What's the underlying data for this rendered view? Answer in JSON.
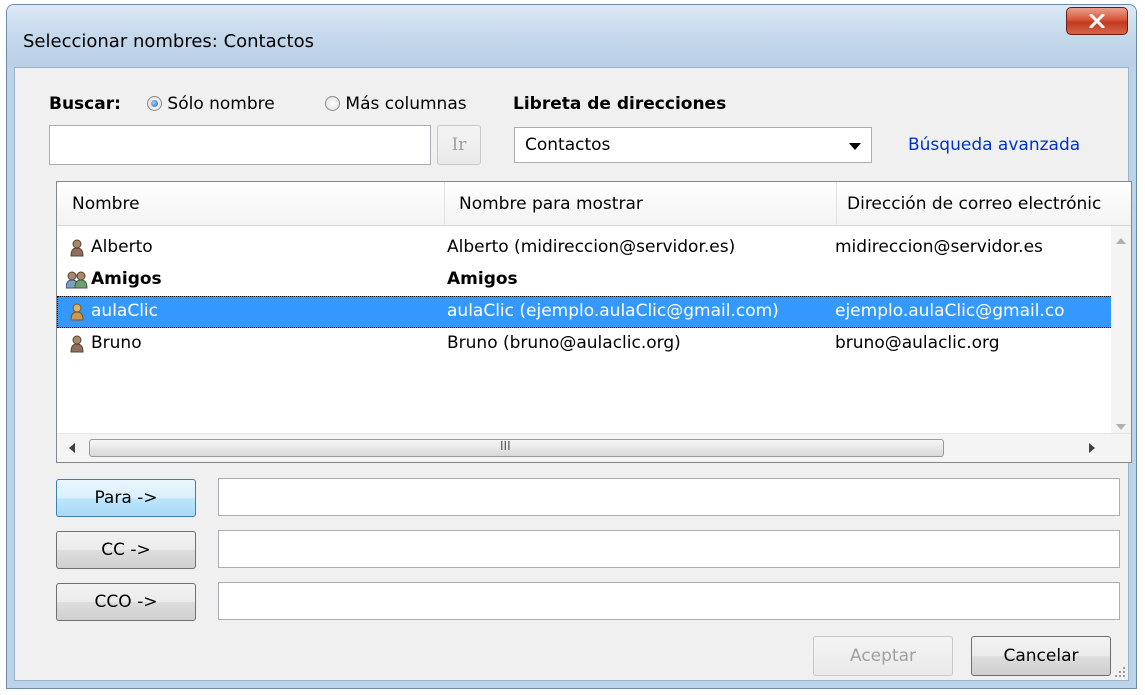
{
  "window": {
    "title": "Seleccionar nombres: Contactos"
  },
  "search": {
    "label": "Buscar:",
    "options": [
      {
        "label": "Sólo nombre",
        "checked": true
      },
      {
        "label": "Más columnas",
        "checked": false
      }
    ],
    "input_value": "",
    "go_button": "Ir"
  },
  "address_book": {
    "label": "Libreta de direcciones",
    "selected": "Contactos",
    "advanced_link": "Búsqueda avanzada"
  },
  "list": {
    "columns": [
      "Nombre",
      "Nombre para mostrar",
      "Dirección de correo electrónic"
    ],
    "rows": [
      {
        "name": "Alberto",
        "display": "Alberto (midireccion@servidor.es)",
        "email": "midireccion@servidor.es",
        "icon": "contact-icon",
        "bold": false,
        "selected": false
      },
      {
        "name": "Amigos",
        "display": "Amigos",
        "email": "",
        "icon": "group-icon",
        "bold": true,
        "selected": false
      },
      {
        "name": "aulaClic",
        "display": "aulaClic (ejemplo.aulaClic@gmail.com)",
        "email": "ejemplo.aulaClic@gmail.co",
        "icon": "contact-icon",
        "bold": false,
        "selected": true
      },
      {
        "name": "Bruno",
        "display": "Bruno (bruno@aulaclic.org)",
        "email": "bruno@aulaclic.org",
        "icon": "contact-icon",
        "bold": false,
        "selected": false
      }
    ],
    "scroll_grip": "III"
  },
  "recipients": {
    "to_button": "Para ->",
    "to_value": "",
    "cc_button": "CC ->",
    "cc_value": "",
    "bcc_button": "CCO ->",
    "bcc_value": ""
  },
  "footer": {
    "ok_button": "Aceptar",
    "cancel_button": "Cancelar"
  },
  "colors": {
    "selection": "#3399ff",
    "link": "#0033cc",
    "close": "#c23a1f"
  }
}
